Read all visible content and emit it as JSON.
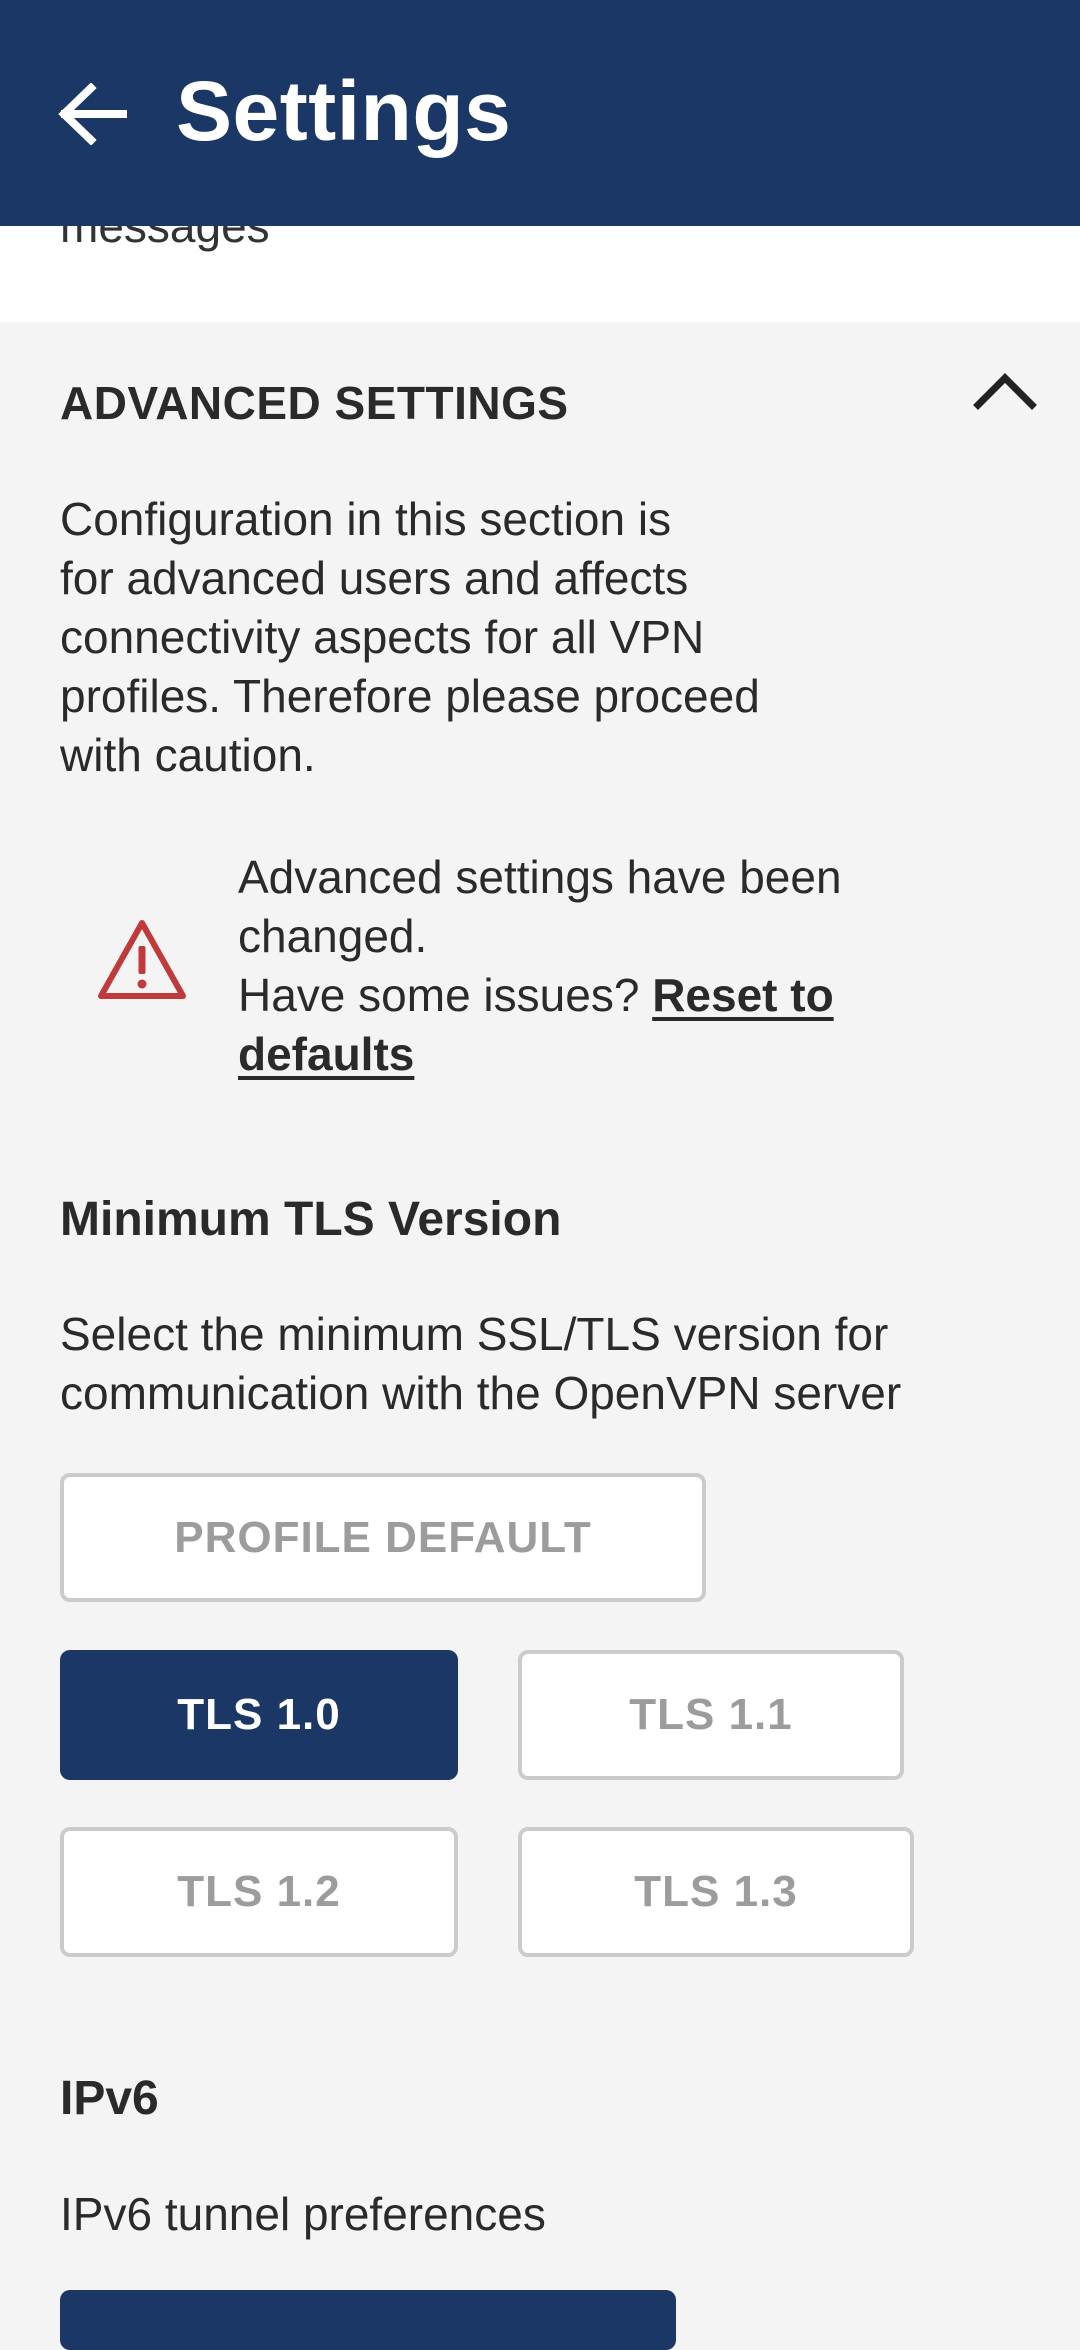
{
  "app_bar": {
    "title": "Settings",
    "back_icon": "arrow-left-icon",
    "background_color": "#1b3766"
  },
  "previous_section": {
    "trailing_text": "messages"
  },
  "advanced_settings": {
    "title": "ADVANCED SETTINGS",
    "collapse_icon": "chevron-up-icon",
    "description": "Configuration in this section is\nfor advanced users and affects\nconnectivity aspects for all VPN\nprofiles. Therefore please proceed\nwith caution.",
    "warning": {
      "icon": "warning-triangle-icon",
      "icon_color": "#c0393b",
      "line1": "Advanced settings have been changed.",
      "line2_prefix": "Have some issues? ",
      "reset_link": "Reset to defaults"
    }
  },
  "tls": {
    "title": "Minimum TLS Version",
    "description": "Select the minimum SSL/TLS version for\ncommunication with the OpenVPN server",
    "options": [
      {
        "label": "PROFILE DEFAULT",
        "selected": false
      },
      {
        "label": "TLS 1.0",
        "selected": true
      },
      {
        "label": "TLS 1.1",
        "selected": false
      },
      {
        "label": "TLS 1.2",
        "selected": false
      },
      {
        "label": "TLS 1.3",
        "selected": false
      }
    ],
    "selected_color": "#1b3766"
  },
  "ipv6": {
    "title": "IPv6",
    "description": "IPv6 tunnel preferences"
  }
}
